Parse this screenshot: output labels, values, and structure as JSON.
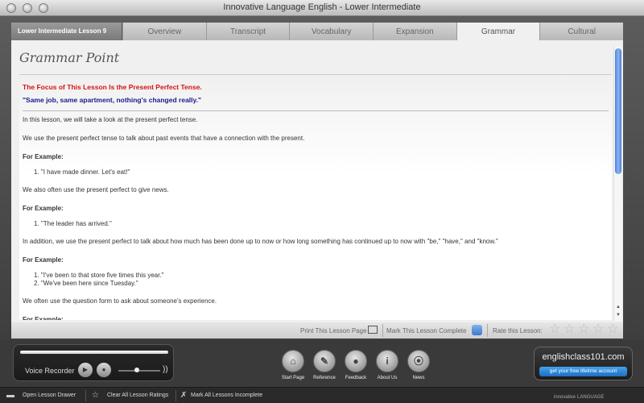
{
  "window": {
    "title": "Innovative Language English - Lower Intermediate"
  },
  "tabs": {
    "lesson": "Lower Intermediate Lesson 9",
    "items": [
      "Overview",
      "Transcript",
      "Vocabulary",
      "Expansion",
      "Grammar",
      "Cultural"
    ],
    "active": "Grammar"
  },
  "panel": {
    "title": "Grammar Point"
  },
  "content": {
    "focus": "The Focus of This Lesson Is the Present Perfect Tense.",
    "quote": "\"Same job, same apartment, nothing's changed really.\"",
    "p1": "In this lesson, we will take a look at the present perfect tense.",
    "p2": "We use the present perfect tense to talk about past events that have a connection with the present.",
    "example_heading": "For Example:",
    "ex1": [
      "1.  \"I have made dinner. Let's eat!\""
    ],
    "p3": "We also often use the present perfect to give news.",
    "ex2": [
      "1.  \"The leader has arrived.\""
    ],
    "p4": "In addition, we use the present perfect to talk about how much has been done up to now or how long something has continued up to now with \"be,\" \"have,\" and \"know.\"",
    "ex3": [
      "1.  \"I've been to that store five times this year.\"",
      "2.  \"We've been here since Tuesday.\""
    ],
    "p5": "We often use the question form to ask about someone's experience."
  },
  "lesson_strip": {
    "print": "Print This Lesson Page",
    "mark": "Mark This Lesson Complete",
    "rate": "Rate this Lesson:",
    "rating": 0,
    "rating_max": 5
  },
  "recorder": {
    "label": "Voice Recorder"
  },
  "nav": [
    "Start Page",
    "Reference",
    "Feedback",
    "About Us",
    "News"
  ],
  "brand": {
    "name": "englishclass101.com",
    "cta": "get your free lifetime account"
  },
  "bottom_bar": {
    "open_drawer": "Open Lesson Drawer",
    "clear_ratings": "Clear All Lesson Ratings",
    "mark_incomplete": "Mark All Lessons Incomplete",
    "logo": "innovative",
    "logo_sub": "LANGUAGE"
  },
  "colors": {
    "accent_blue": "#3b7ad0",
    "focus_red": "#d41414",
    "quote_blue": "#1a1a8c"
  }
}
